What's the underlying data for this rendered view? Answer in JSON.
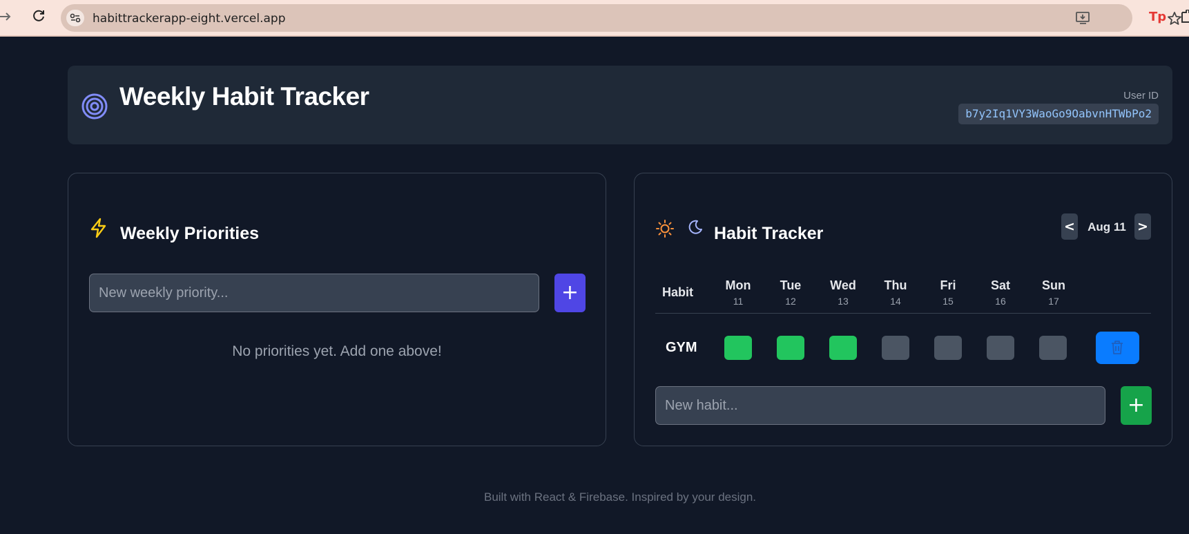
{
  "browser": {
    "url": "habittrackerapp-eight.vercel.app",
    "extension_label": "Tp"
  },
  "header": {
    "title": "Weekly Habit Tracker",
    "user_id_label": "User ID",
    "user_id": "b7y2Iq1VY3WaoGo9OabvnHTWbPo2",
    "accent_color": "#818cf8"
  },
  "priorities": {
    "title": "Weekly Priorities",
    "input_placeholder": "New weekly priority...",
    "add_label": "+",
    "empty_message": "No priorities yet. Add one above!"
  },
  "tracker": {
    "title": "Habit Tracker",
    "prev_label": "<",
    "next_label": ">",
    "week_label": "Aug 11",
    "habit_column_label": "Habit",
    "days": [
      {
        "name": "Mon",
        "date": "11"
      },
      {
        "name": "Tue",
        "date": "12"
      },
      {
        "name": "Wed",
        "date": "13"
      },
      {
        "name": "Thu",
        "date": "14"
      },
      {
        "name": "Fri",
        "date": "15"
      },
      {
        "name": "Sat",
        "date": "16"
      },
      {
        "name": "Sun",
        "date": "17"
      }
    ],
    "habits": [
      {
        "name": "GYM",
        "completed": [
          true,
          true,
          true,
          false,
          false,
          false,
          false
        ]
      }
    ],
    "input_placeholder": "New habit...",
    "add_label": "+",
    "colors": {
      "done": "#22c55e",
      "todo": "#4b5563",
      "delete": "#0a7cff",
      "add": "#16a34a"
    }
  },
  "footer": {
    "text": "Built with React & Firebase. Inspired by your design."
  }
}
